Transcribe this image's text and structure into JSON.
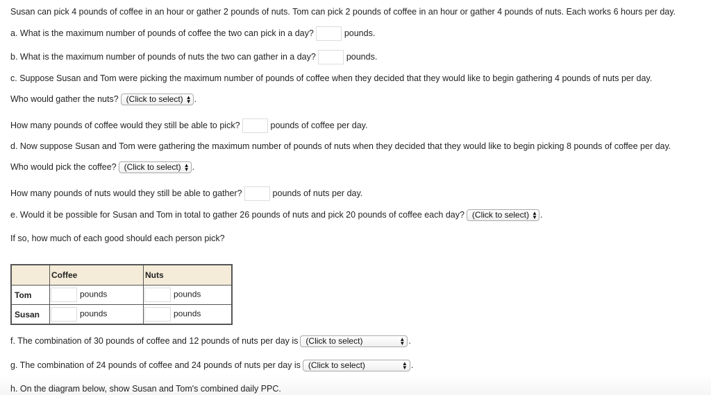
{
  "intro": "Susan can pick 4 pounds of coffee in an hour or gather 2 pounds of nuts. Tom can pick 2 pounds of coffee in an hour or gather 4 pounds of nuts. Each works 6 hours per day.",
  "a": {
    "question": "a.  What is the maximum number of pounds of coffee the two can pick in a day?",
    "value": "",
    "unit": "pounds."
  },
  "b": {
    "question": "b.  What is the maximum number of pounds of nuts the two can gather in a day?",
    "value": "",
    "unit": "pounds."
  },
  "c": {
    "question": "c.  Suppose Susan and Tom were picking the maximum number of pounds of coffee when they decided that they would like to begin gathering 4 pounds of nuts per day.",
    "who_label": "Who would gather the nuts?",
    "who_select": "(Click to select)",
    "how_many_label": "How many pounds of coffee would they still be able to pick?",
    "how_many_value": "",
    "how_many_unit": "pounds of coffee per day."
  },
  "d": {
    "question": "d.  Now suppose Susan and Tom were gathering the maximum number of pounds of nuts when they decided that they would like to begin picking 8 pounds of coffee per day.",
    "who_label": "Who would pick the coffee?",
    "who_select": "(Click to select)",
    "how_many_label": "How many pounds of nuts would they still be able to gather?",
    "how_many_value": "",
    "how_many_unit": "pounds of nuts per day."
  },
  "e": {
    "question": "e.  Would it be possible for Susan and Tom in total to gather 26 pounds of nuts and pick 20 pounds of coffee each day?",
    "select": "(Click to select)",
    "followup": "If so, how much of each good should each person pick?",
    "table": {
      "headers": [
        "",
        "Coffee",
        "Nuts"
      ],
      "rows": [
        {
          "name": "Tom",
          "coffee_value": "",
          "coffee_unit": "pounds",
          "nuts_value": "",
          "nuts_unit": "pounds"
        },
        {
          "name": "Susan",
          "coffee_value": "",
          "coffee_unit": "pounds",
          "nuts_value": "",
          "nuts_unit": "pounds"
        }
      ]
    }
  },
  "f": {
    "question": "f.  The combination of 30 pounds of coffee and 12 pounds of nuts per day is",
    "select": "(Click to select)"
  },
  "g": {
    "question": "g.  The combination of 24 pounds of coffee and 24 pounds of nuts per day is",
    "select": "(Click to select)"
  },
  "h": {
    "question": "h.  On the diagram below, show Susan and Tom's combined daily PPC."
  },
  "punct": {
    "period": "."
  },
  "icons": {
    "select_arrows": "updown-arrows-icon"
  }
}
